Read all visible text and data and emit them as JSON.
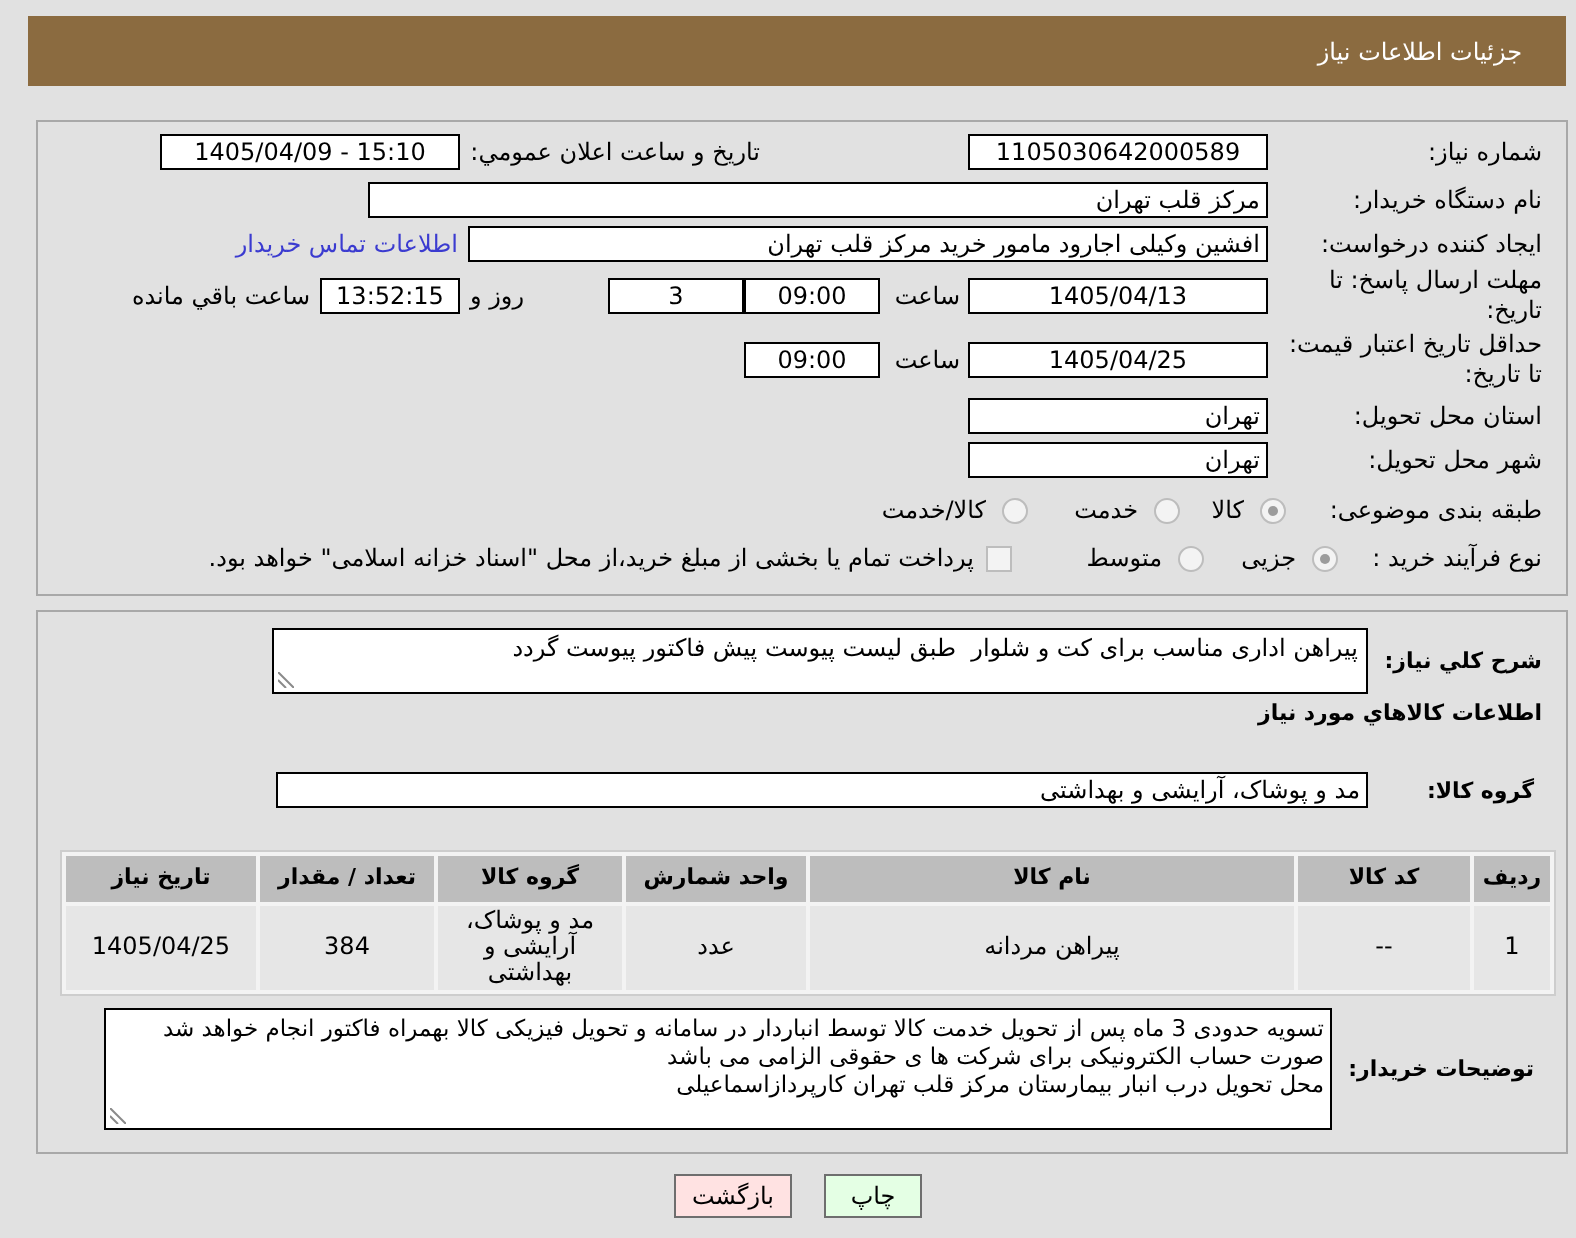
{
  "header": {
    "title": "جزئیات اطلاعات نیاز"
  },
  "details": {
    "need_number": {
      "label": "شماره نیاز:",
      "value": "1105030642000589"
    },
    "announcement": {
      "label": "تاریخ و ساعت اعلان عمومي:",
      "value": "1405/04/09 - 15:10"
    },
    "buyer_org": {
      "label": "نام دستگاه خریدار:",
      "value": "مرکز قلب تهران"
    },
    "requester": {
      "label": "ایجاد کننده درخواست:",
      "value": "افشین وکیلی اجارود مامور خرید مرکز قلب تهران",
      "contact_link": "اطلاعات تماس خریدار"
    },
    "reply_deadline": {
      "label": "مهلت ارسال پاسخ: تا تاریخ:",
      "date": "1405/04/13",
      "time_label": "ساعت",
      "time": "09:00",
      "days": "3",
      "days_label": "روز و",
      "remaining": "13:52:15",
      "remaining_label": "ساعت باقي مانده"
    },
    "price_validity": {
      "label": "حداقل تاریخ اعتبار قیمت: تا تاریخ:",
      "date": "1405/04/25",
      "time_label": "ساعت",
      "time": "09:00"
    },
    "province": {
      "label": "استان محل تحویل:",
      "value": "تهران"
    },
    "city": {
      "label": "شهر محل تحویل:",
      "value": "تهران"
    },
    "category": {
      "label": "طبقه بندی موضوعی:",
      "options": [
        {
          "label": "کالا",
          "selected": true
        },
        {
          "label": "خدمت",
          "selected": false
        },
        {
          "label": "کالا/خدمت",
          "selected": false
        }
      ]
    },
    "purchase_type": {
      "label": "نوع فرآیند خرید :",
      "options": [
        {
          "label": "جزیی",
          "selected": true
        },
        {
          "label": "متوسط",
          "selected": false
        }
      ],
      "treasury": {
        "label": "پرداخت تمام یا بخشی از مبلغ خرید،از محل \"اسناد خزانه اسلامی\" خواهد بود.",
        "checked": false
      }
    }
  },
  "description": {
    "label": "شرح کلي نیاز:",
    "value": "پیراهن اداری مناسب برای کت و شلوار  طبق لیست پیوست پیش فاکتور پیوست گردد"
  },
  "items": {
    "title": "اطلاعات کالاهاي مورد نیاز",
    "group": {
      "label": "گروه کالا:",
      "value": "مد و پوشاک، آرایشی و بهداشتی"
    },
    "table": {
      "columns": [
        "ردیف",
        "کد کالا",
        "نام کالا",
        "واحد شمارش",
        "گروه کالا",
        "تعداد / مقدار",
        "تاریخ نیاز"
      ],
      "rows": [
        [
          "1",
          "--",
          "پیراهن مردانه",
          "عدد",
          "مد و پوشاک، آرایشی و بهداشتی",
          "384",
          "1405/04/25"
        ]
      ]
    }
  },
  "buyer_notes": {
    "label": "توضیحات خریدار:",
    "value": "تسویه حدودی 3 ماه پس از تحویل خدمت کالا توسط انباردار در سامانه و تحویل فیزیکی کالا بهمراه فاکتور انجام خواهد شد\nصورت حساب الکترونیکی برای شرکت ها ی حقوقی الزامی می باشد\nمحل تحویل درب انبار بیمارستان مرکز قلب تهران کارپردازاسماعیلی"
  },
  "buttons": [
    {
      "kind": "print",
      "label": "چاپ"
    },
    {
      "kind": "back",
      "label": "بازگشت"
    }
  ]
}
